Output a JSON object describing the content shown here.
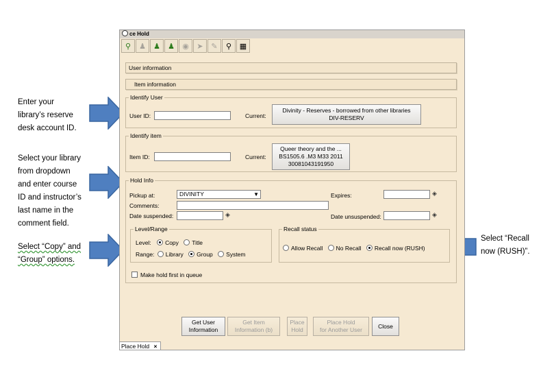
{
  "annotations": {
    "left": [
      [
        "Enter your",
        "library’s reserve",
        "desk account ID."
      ],
      [
        "Select your library",
        "from dropdown",
        "and enter course",
        "ID and instructor’s",
        "last name  in the",
        "comment field."
      ],
      [
        "Select “Copy” and",
        "“Group” options."
      ]
    ],
    "right": [
      "Select “Recall",
      "now (RUSH)”."
    ]
  },
  "window": {
    "title": "ce Hold",
    "toolbar_icons": [
      "user-search-icon",
      "user-icon",
      "user-hold-icon",
      "user-lock-icon",
      "disc-icon",
      "arrow-icon",
      "pen-icon",
      "barcode-search-icon",
      "book-stack-icon"
    ],
    "user_info_label": "User information",
    "item_info_label": "Item information",
    "identify_user": {
      "legend": "Identify User",
      "user_id_label": "User ID:",
      "user_id_value": "",
      "current_label": "Current:",
      "current_line1": "Divinity - Reserves - borrowed from other libraries",
      "current_line2": "DIV-RESERV"
    },
    "identify_item": {
      "legend": "Identify item",
      "item_id_label": "Item ID:",
      "item_id_value": "",
      "current_label": "Current:",
      "current_line1": "Queer theory and the ...",
      "current_line2": "BS1505.6 .M3 M33 2011",
      "current_line3": "30081043191950"
    },
    "hold_info": {
      "legend": "Hold Info",
      "pickup_label": "Pickup at:",
      "pickup_value": "DIVINITY",
      "expires_label": "Expires:",
      "comments_label": "Comments:",
      "date_suspended_label": "Date suspended:",
      "date_unsuspended_label": "Date unsuspended:",
      "level_range": {
        "legend": "Level/Range",
        "level_label": "Level:",
        "level_copy": "Copy",
        "level_title": "Title",
        "range_label": "Range:",
        "range_library": "Library",
        "range_group": "Group",
        "range_system": "System"
      },
      "recall_status": {
        "legend": "Recall status",
        "allow": "Allow Recall",
        "no": "No Recall",
        "rush": "Recall now (RUSH)"
      },
      "first_in_queue": "Make hold first in queue"
    },
    "buttons": {
      "get_user_1": "Get User",
      "get_user_2": "Information",
      "get_item_1": "Get Item",
      "get_item_2": "Information (b)",
      "place_1": "Place",
      "place_2": "Hold",
      "place_another_1": "Place Hold",
      "place_another_2": "for Another User",
      "close": "Close"
    },
    "status_tab": "Place Hold",
    "status_tab_close": "×"
  },
  "colors": {
    "arrow": "#4f7fc0",
    "arrow_border": "#3a66a0",
    "window_bg": "#f6e9d2"
  }
}
